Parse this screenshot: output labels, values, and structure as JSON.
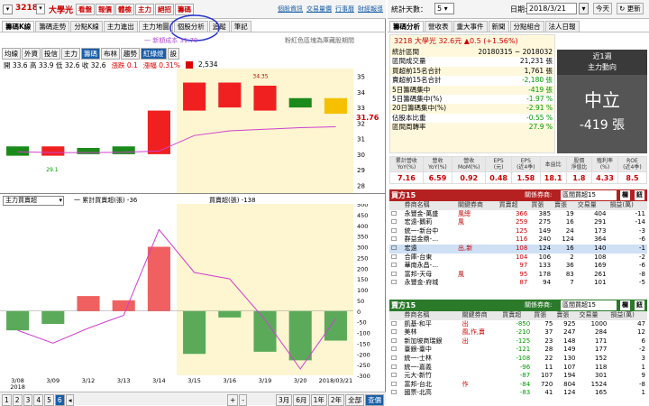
{
  "top": {
    "code": "3218",
    "name": "大學光",
    "buttons": [
      "看盤",
      "報價",
      "體檢",
      "主力",
      "絕招",
      "籌碼"
    ],
    "links": [
      "個股資訊",
      "交易量價",
      "行事曆",
      "財經報導"
    ]
  },
  "tabs": [
    "籌碼K線",
    "籌碼走勢",
    "分點K線",
    "主力進出",
    "主力地圖",
    "個股分析",
    "追蹤",
    "筆記"
  ],
  "chart_head": {
    "legend_line": "一  新額成本 31.70",
    "note": "粉紅色區塊為庫藏股期間",
    "sub_tabs": [
      "均線",
      "外資",
      "投信",
      "主力",
      "籌碼",
      "布林",
      "趨勢",
      "紅綠燈",
      "設"
    ],
    "ohlc": "開 33.6  高 33.9  低 32.6  收 32.6",
    "change": "漲跌 0.1",
    "pct": "漲幅 0.31%",
    "vol": "2,534",
    "price_label": "31.76",
    "peak": "34.35",
    "low": "29.1"
  },
  "lower": {
    "select": "主力買賣超",
    "legend1": "一 累計買賣超(張) -36",
    "legend2": "買賣超(張) -138"
  },
  "chart_data": [
    {
      "type": "candlestick",
      "x": [
        "3/08",
        "3/09",
        "3/12",
        "3/13",
        "3/14",
        "3/15",
        "3/16",
        "3/19",
        "3/20",
        "3/21"
      ],
      "open": [
        30.5,
        29.9,
        30.4,
        30.5,
        30.0,
        32.8,
        33.0,
        32.8,
        33.6,
        33.6
      ],
      "close": [
        29.9,
        30.5,
        30.0,
        30.0,
        32.8,
        34.6,
        34.6,
        34.4,
        33.0,
        32.6
      ],
      "ylim": [
        27.5,
        35.5
      ],
      "yticks": [
        28,
        29,
        30,
        31,
        32,
        33,
        34,
        35
      ],
      "avg_line": [
        30.15,
        30.1,
        30.1,
        30.12,
        30.2,
        31.2,
        31.5,
        31.6,
        31.7,
        31.76
      ]
    },
    {
      "type": "bar",
      "x": [
        "3/08",
        "3/09",
        "3/12",
        "3/13",
        "3/14",
        "3/15",
        "3/16",
        "3/19",
        "3/20",
        "3/21"
      ],
      "values": [
        -90,
        -60,
        70,
        50,
        300,
        -200,
        -30,
        -190,
        -230,
        -138
      ],
      "cumulative": [
        -90,
        -150,
        -80,
        -20,
        380,
        180,
        150,
        -40,
        -270,
        -36
      ],
      "ylim": [
        -300,
        500
      ],
      "yticks": [
        500,
        450,
        400,
        350,
        300,
        250,
        200,
        150,
        100,
        50,
        0,
        -50,
        -100,
        -150,
        -200,
        -250,
        -300
      ],
      "xlabels": [
        "3/08\n2018",
        "3/09",
        "3/12",
        "3/13",
        "3/14",
        "3/15",
        "3/16",
        "3/19",
        "3/20",
        "2018/03/21"
      ]
    }
  ],
  "bottom_bar": {
    "pages": [
      "1",
      "2",
      "3",
      "4",
      "5",
      "6"
    ],
    "btns": [
      "3月",
      "6月",
      "1年",
      "2年",
      "全部",
      "查價"
    ],
    "zoom": [
      "+",
      "-"
    ]
  },
  "right": {
    "days_label": "統計天數：",
    "days_val": "5",
    "date_label": "日期:",
    "date_val": "2018/3/21",
    "today": "今天",
    "refresh": "更新",
    "tabs": [
      "籌碼分析",
      "營收表",
      "重大事件",
      "新聞",
      "分點組合",
      "法人日報"
    ],
    "stock_line": "3218  大學光  32.6元  ▲0.5 (+1.56%)",
    "stats": [
      [
        "統計區間",
        "20180315 ~ 2018032"
      ],
      [
        "區間成交量",
        "21,231 張"
      ],
      [
        "買超前15名合計",
        "1,761 張"
      ],
      [
        "賣超前15名合計",
        "-2,180 張"
      ],
      [
        "5日籌碼集中",
        "-419 張"
      ],
      [
        "5日籌碼集中(%)",
        "-1.97 %"
      ],
      [
        "20日籌碼集中(%)",
        "-2.91 %"
      ],
      [
        "佔股本比重",
        "-0.55 %"
      ],
      [
        "區間周轉率",
        "27.9 %"
      ]
    ],
    "week": "近1週",
    "flow": "主力動向",
    "neutral": "中立",
    "neutral_val": "-419 張",
    "fund_heads": [
      "累計營收\nYoY(%)",
      "營收\nYoY(%)",
      "營收\nMoM(%)",
      "EPS\n(元)",
      "EPS\n(近4季)",
      "本益比",
      "股價\n淨值比",
      "殖利率\n(%)",
      "ROE\n(近4季)"
    ],
    "fund_vals": [
      "7.16",
      "6.59",
      "0.92",
      "0.48",
      "1.58",
      "18.1",
      "1.8",
      "4.33",
      "8.5"
    ],
    "buy_title": "買方15",
    "sell_title": "賣方15",
    "related": "關係券商:",
    "related_sel": "區間買超15",
    "btn1": "欄",
    "btn2": "鈕",
    "cols": [
      "券商名稱",
      "關鍵券商",
      "買賣超",
      "買張",
      "賣張",
      "交易量",
      "損益(萬)"
    ],
    "buy_rows": [
      [
        "永豐金-萬盛",
        "風總",
        "366",
        "385",
        "19",
        "404",
        "-11"
      ],
      [
        "宏遠-鵝莉",
        "風",
        "259",
        "275",
        "16",
        "291",
        "-14"
      ],
      [
        "統一-新台中",
        "",
        "125",
        "149",
        "24",
        "173",
        "-3"
      ],
      [
        "群益金鼎-…",
        "",
        "116",
        "240",
        "124",
        "364",
        "-6"
      ],
      [
        "宏遠",
        "出,新",
        "108",
        "124",
        "16",
        "140",
        "-1"
      ],
      [
        "合庫-台東",
        "",
        "104",
        "106",
        "2",
        "108",
        "-2"
      ],
      [
        "華南永昌-…",
        "",
        "97",
        "133",
        "36",
        "169",
        "-6"
      ],
      [
        "富邦-天母",
        "風",
        "95",
        "178",
        "83",
        "261",
        "-8"
      ],
      [
        "永豐金-府城",
        "",
        "87",
        "94",
        "7",
        "101",
        "-5"
      ]
    ],
    "sell_rows": [
      [
        "凱基-和平",
        "出",
        "-850",
        "75",
        "925",
        "1000",
        "47"
      ],
      [
        "美林",
        "風,作,賣",
        "-210",
        "37",
        "247",
        "284",
        "12"
      ],
      [
        "新加坡商瑞銀",
        "出",
        "-125",
        "23",
        "148",
        "171",
        "6"
      ],
      [
        "臺銀-臺中",
        "",
        "-121",
        "28",
        "149",
        "177",
        "-2"
      ],
      [
        "統一-士林",
        "",
        "-108",
        "22",
        "130",
        "152",
        "3"
      ],
      [
        "統一-嘉義",
        "",
        "-96",
        "11",
        "107",
        "118",
        "1"
      ],
      [
        "元大-新竹",
        "",
        "-87",
        "107",
        "194",
        "301",
        "9"
      ],
      [
        "富邦-台北",
        "作",
        "-84",
        "720",
        "804",
        "1524",
        "-8"
      ],
      [
        "國票-北高",
        "",
        "-83",
        "41",
        "124",
        "165",
        "1"
      ]
    ]
  }
}
